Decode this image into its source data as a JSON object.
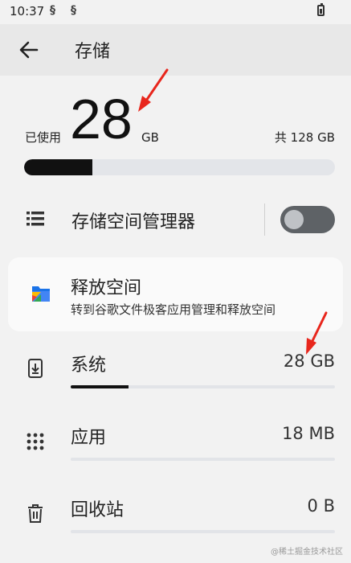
{
  "status_bar": {
    "time": "10:37",
    "icons": [
      "sync-icon",
      "sync-icon",
      "battery-icon"
    ]
  },
  "app_bar": {
    "title": "存储",
    "back_icon": "arrow-left-icon"
  },
  "summary": {
    "used_label": "已使用",
    "used_value": "28",
    "used_unit": "GB",
    "total": "共 128 GB",
    "used_fraction": 0.22
  },
  "storage_manager": {
    "label": "存储空间管理器",
    "toggle_on": false,
    "icon": "list-icon"
  },
  "free_up": {
    "title": "释放空间",
    "subtitle": "转到谷歌文件极客应用管理和释放空间",
    "icon": "files-app-icon"
  },
  "categories": [
    {
      "label": "系统",
      "value": "28 GB",
      "fraction": 0.22,
      "icon": "phone-download-icon"
    },
    {
      "label": "应用",
      "value": "18 MB",
      "fraction": 0.0,
      "icon": "apps-grid-icon"
    },
    {
      "label": "回收站",
      "value": "0 B",
      "fraction": 0.0,
      "icon": "trash-icon"
    }
  ],
  "watermark": "@稀土掘金技术社区",
  "colors": {
    "background": "#f2f2f2",
    "app_bar": "#e8e8e8",
    "bar_fill": "#111111",
    "annotation_arrow": "#e8261c"
  }
}
